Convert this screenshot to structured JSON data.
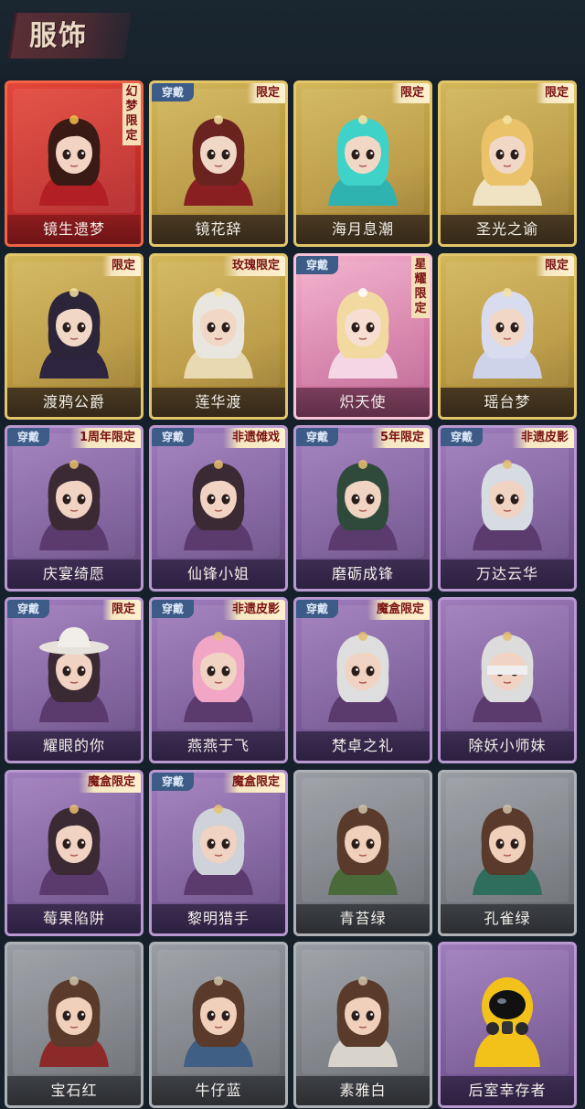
{
  "header": {
    "title": "服饰"
  },
  "labels": {
    "wear": "穿戴"
  },
  "colors": {
    "background": "#15202b",
    "red_tier": "#c62f2a",
    "gold_tier": "#b8963c",
    "pink_tier": "#d67fa8",
    "purple_tier": "#7d5c9c",
    "grey_tier": "#7a7e84",
    "wear_tag": "#3c5b86"
  },
  "costumes": [
    {
      "name": "镜生遗梦",
      "tier": "red",
      "tag": "幻梦限定",
      "vertical": true,
      "worn": false,
      "icon": "hanfu-queen-portrait"
    },
    {
      "name": "镜花辞",
      "tier": "gold",
      "tag": "限定",
      "vertical": false,
      "worn": true,
      "icon": "red-hood-portrait"
    },
    {
      "name": "海月息潮",
      "tier": "gold",
      "tag": "限定",
      "vertical": false,
      "worn": false,
      "icon": "sea-teal-portrait"
    },
    {
      "name": "圣光之谕",
      "tier": "gold",
      "tag": "限定",
      "vertical": false,
      "worn": false,
      "icon": "holy-blonde-portrait"
    },
    {
      "name": "渡鸦公爵",
      "tier": "gold",
      "tag": "限定",
      "vertical": false,
      "worn": false,
      "icon": "raven-duke-portrait"
    },
    {
      "name": "莲华渡",
      "tier": "gold",
      "tag": "玫瑰限定",
      "vertical": false,
      "worn": false,
      "icon": "lotus-white-portrait"
    },
    {
      "name": "炽天使",
      "tier": "pink",
      "tag": "星耀限定",
      "vertical": true,
      "worn": true,
      "icon": "seraph-portrait"
    },
    {
      "name": "瑶台梦",
      "tier": "gold",
      "tag": "限定",
      "vertical": false,
      "worn": false,
      "icon": "jade-dream-portrait"
    },
    {
      "name": "庆宴绮愿",
      "tier": "purple",
      "tag": "1周年限定",
      "vertical": false,
      "worn": true,
      "icon": "cake-party-portrait"
    },
    {
      "name": "仙锋小姐",
      "tier": "purple",
      "tag": "非遗傩戏",
      "vertical": false,
      "worn": true,
      "icon": "mask-lady-portrait"
    },
    {
      "name": "磨砺成锋",
      "tier": "purple",
      "tag": "5年限定",
      "vertical": false,
      "worn": true,
      "icon": "green-warrior-portrait"
    },
    {
      "name": "万达云华",
      "tier": "purple",
      "tag": "非遗皮影",
      "vertical": false,
      "worn": true,
      "icon": "silver-hair-portrait"
    },
    {
      "name": "耀眼的你",
      "tier": "purple",
      "tag": "限定",
      "vertical": false,
      "worn": true,
      "icon": "cowboy-hat-portrait"
    },
    {
      "name": "燕燕于飞",
      "tier": "purple",
      "tag": "非遗皮影",
      "vertical": false,
      "worn": true,
      "icon": "pink-swallow-portrait"
    },
    {
      "name": "梵卓之礼",
      "tier": "purple",
      "tag": "魔盒限定",
      "vertical": false,
      "worn": true,
      "icon": "vampire-portrait"
    },
    {
      "name": "除妖小师妹",
      "tier": "purple",
      "tag": "",
      "vertical": false,
      "worn": false,
      "icon": "blindfold-girl-portrait"
    },
    {
      "name": "莓果陷阱",
      "tier": "purple",
      "tag": "魔盒限定",
      "vertical": false,
      "worn": false,
      "icon": "berry-hat-portrait"
    },
    {
      "name": "黎明猎手",
      "tier": "purple",
      "tag": "魔盒限定",
      "vertical": false,
      "worn": true,
      "icon": "dawn-hunter-portrait"
    },
    {
      "name": "青苔绿",
      "tier": "grey",
      "tag": "",
      "vertical": false,
      "worn": false,
      "icon": "girl-green-portrait"
    },
    {
      "name": "孔雀绿",
      "tier": "grey",
      "tag": "",
      "vertical": false,
      "worn": false,
      "icon": "girl-peacock-portrait"
    },
    {
      "name": "宝石红",
      "tier": "grey",
      "tag": "",
      "vertical": false,
      "worn": false,
      "icon": "girl-red-portrait"
    },
    {
      "name": "牛仔蓝",
      "tier": "grey",
      "tag": "",
      "vertical": false,
      "worn": false,
      "icon": "girl-denim-portrait"
    },
    {
      "name": "素雅白",
      "tier": "grey",
      "tag": "",
      "vertical": false,
      "worn": false,
      "icon": "girl-white-portrait"
    },
    {
      "name": "后室幸存者",
      "tier": "purple",
      "tag": "",
      "vertical": false,
      "worn": false,
      "icon": "hazmat-yellow-portrait"
    }
  ]
}
